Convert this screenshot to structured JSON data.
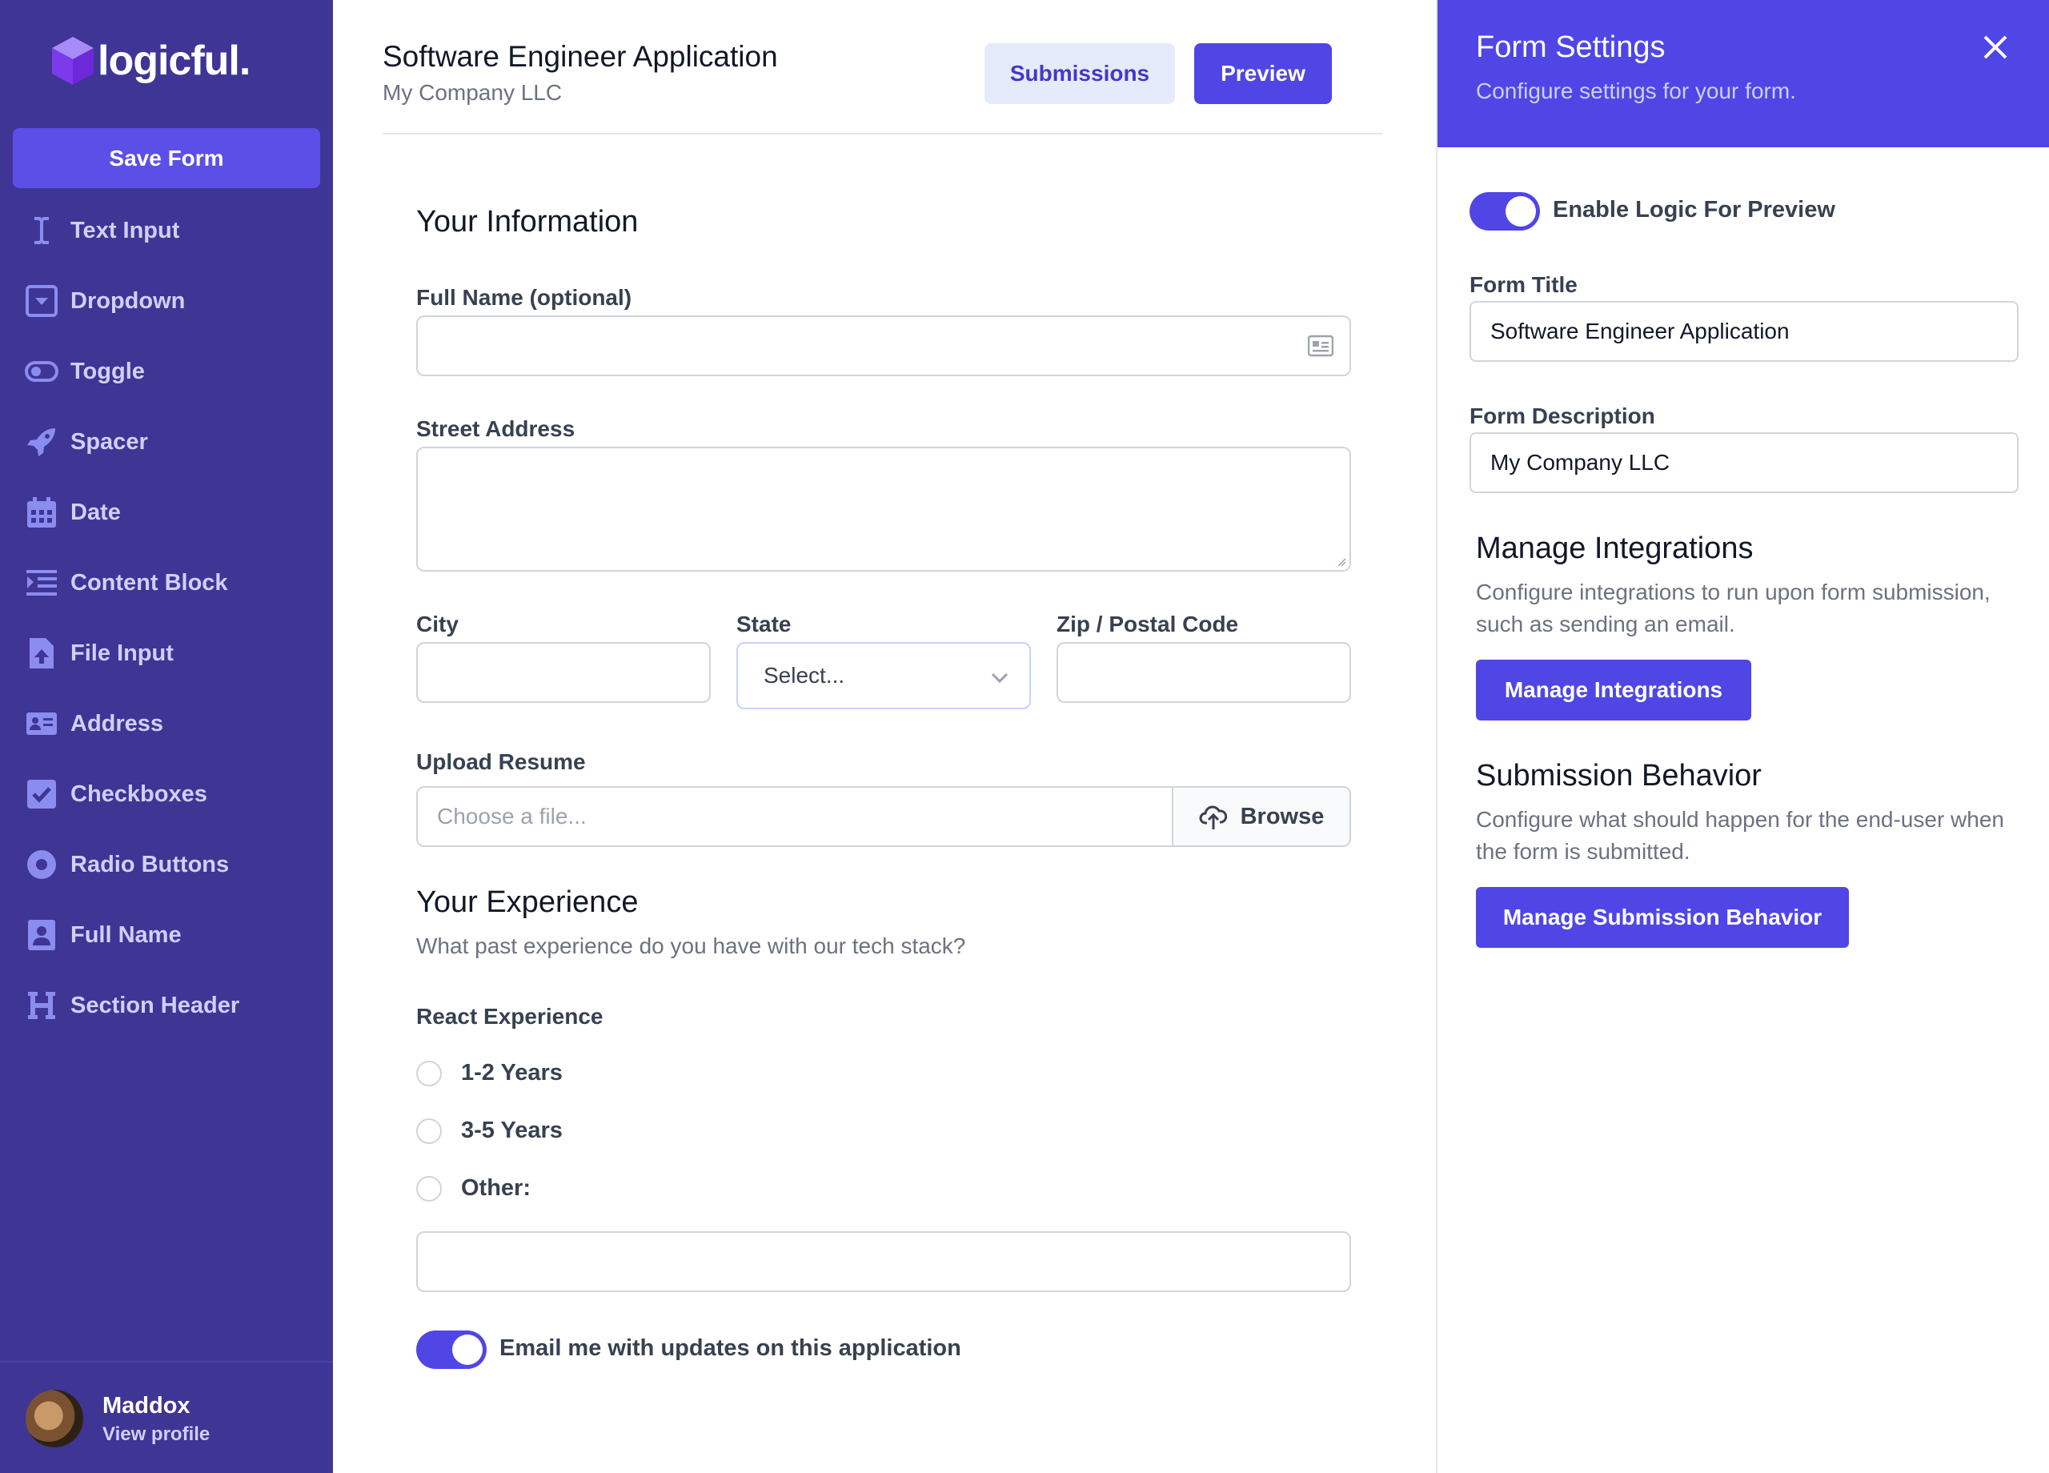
{
  "brand": {
    "name": "logicful."
  },
  "sidebar": {
    "save_label": "Save Form",
    "items": [
      {
        "label": "Text Input",
        "icon": "text-cursor-icon"
      },
      {
        "label": "Dropdown",
        "icon": "dropdown-icon"
      },
      {
        "label": "Toggle",
        "icon": "toggle-icon"
      },
      {
        "label": "Spacer",
        "icon": "rocket-icon"
      },
      {
        "label": "Date",
        "icon": "calendar-icon"
      },
      {
        "label": "Content Block",
        "icon": "content-block-icon"
      },
      {
        "label": "File Input",
        "icon": "file-upload-icon"
      },
      {
        "label": "Address",
        "icon": "address-card-icon"
      },
      {
        "label": "Checkboxes",
        "icon": "checkbox-icon"
      },
      {
        "label": "Radio Buttons",
        "icon": "radio-button-icon"
      },
      {
        "label": "Full Name",
        "icon": "user-icon"
      },
      {
        "label": "Section Header",
        "icon": "heading-icon"
      }
    ],
    "user": {
      "name": "Maddox",
      "link": "View profile"
    }
  },
  "header": {
    "title": "Software Engineer Application",
    "subtitle": "My Company LLC",
    "submissions_label": "Submissions",
    "preview_label": "Preview"
  },
  "form": {
    "section1": "Your Information",
    "full_name_label": "Full Name (optional)",
    "street_label": "Street Address",
    "city_label": "City",
    "state_label": "State",
    "state_value": "Select...",
    "zip_label": "Zip / Postal Code",
    "resume_label": "Upload Resume",
    "resume_placeholder": "Choose a file...",
    "browse_label": "Browse",
    "section2": "Your Experience",
    "section2_desc": "What past experience do you have with our tech stack?",
    "react_label": "React Experience",
    "options": [
      "1-2 Years",
      "3-5 Years",
      "Other:"
    ],
    "email_toggle_label": "Email me with updates on this application",
    "email_toggle_on": true
  },
  "settings": {
    "title": "Form Settings",
    "subtitle": "Configure settings for your form.",
    "logic_toggle_label": "Enable Logic For Preview",
    "logic_toggle_on": true,
    "form_title_label": "Form Title",
    "form_title_value": "Software Engineer Application",
    "form_desc_label": "Form Description",
    "form_desc_value": "My Company LLC",
    "integrations_title": "Manage Integrations",
    "integrations_desc": "Configure integrations to run upon form submission, such as sending an email.",
    "integrations_button": "Manage Integrations",
    "behavior_title": "Submission Behavior",
    "behavior_desc": "Configure what should happen for the end-user when the form is submitted.",
    "behavior_button": "Manage Submission Behavior"
  },
  "colors": {
    "sidebar": "#3f3594",
    "accent": "#5046e5",
    "nav_text": "#cfd0ff"
  }
}
